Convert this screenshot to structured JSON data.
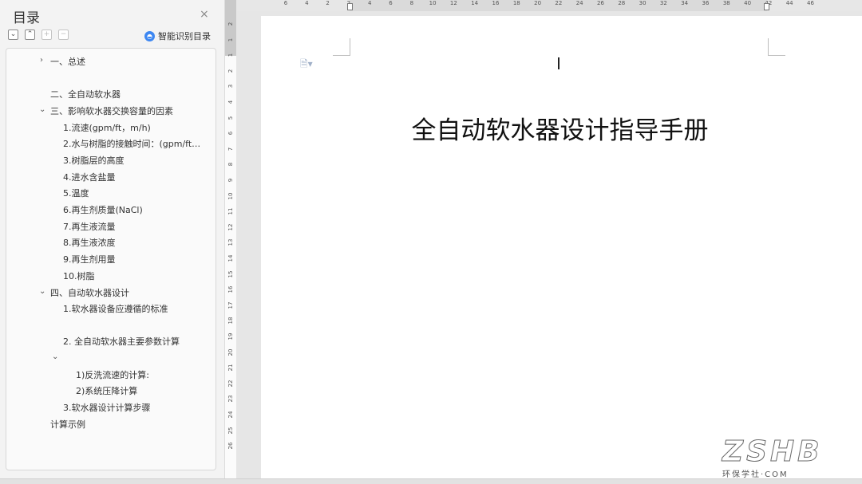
{
  "sidebar": {
    "title": "目录",
    "close": "×",
    "smart_toc": "智能识别目录",
    "toc": [
      {
        "label": "一、总述",
        "level": 1
      },
      {
        "label": "二、全自动软水器",
        "level": 1
      },
      {
        "label": "三、影响软水器交换容量的因素",
        "level": 1
      },
      {
        "label": "1.流速(gpm/ft，m/h)",
        "level": 2
      },
      {
        "label": "2.水与树脂的接触时间：(gpm/ft…",
        "level": 2
      },
      {
        "label": "3.树脂层的高度",
        "level": 2
      },
      {
        "label": "4.进水含盐量",
        "level": 2
      },
      {
        "label": "5.温度",
        "level": 2
      },
      {
        "label": "6.再生剂质量(NaCl)",
        "level": 2
      },
      {
        "label": "7.再生液流量",
        "level": 2
      },
      {
        "label": "8.再生液浓度",
        "level": 2
      },
      {
        "label": "9.再生剂用量",
        "level": 2
      },
      {
        "label": "10.树脂",
        "level": 2
      },
      {
        "label": "四、自动软水器设计",
        "level": 1
      },
      {
        "label": "1.软水器设备应遵循的标准",
        "level": 2
      },
      {
        "label": "2. 全自动软水器主要参数计算",
        "level": 2
      },
      {
        "label": "1)反洗流速的计算:",
        "level": 3
      },
      {
        "label": "2)系统压降计算",
        "level": 3
      },
      {
        "label": "3.软水器设计计算步骤",
        "level": 2
      },
      {
        "label": "计算示例",
        "level": 1
      }
    ]
  },
  "ruler": {
    "h_ticks": [
      "6",
      "4",
      "2",
      "2",
      "4",
      "6",
      "8",
      "10",
      "12",
      "14",
      "16",
      "18",
      "20",
      "22",
      "24",
      "26",
      "28",
      "30",
      "32",
      "34",
      "36",
      "38",
      "40",
      "42",
      "44",
      "46"
    ],
    "v_ticks": [
      "2",
      "1",
      "1",
      "2",
      "3",
      "4",
      "5",
      "6",
      "7",
      "8",
      "9",
      "10",
      "11",
      "12",
      "13",
      "14",
      "15",
      "16",
      "17",
      "18",
      "19",
      "20",
      "21",
      "22",
      "23",
      "24",
      "25",
      "26"
    ]
  },
  "document": {
    "title": "全自动软水器设计指导手册"
  },
  "watermark": {
    "big": "ZSHB",
    "small": "环保学社·COM"
  },
  "colors": {
    "accent": "#3d87f2"
  }
}
